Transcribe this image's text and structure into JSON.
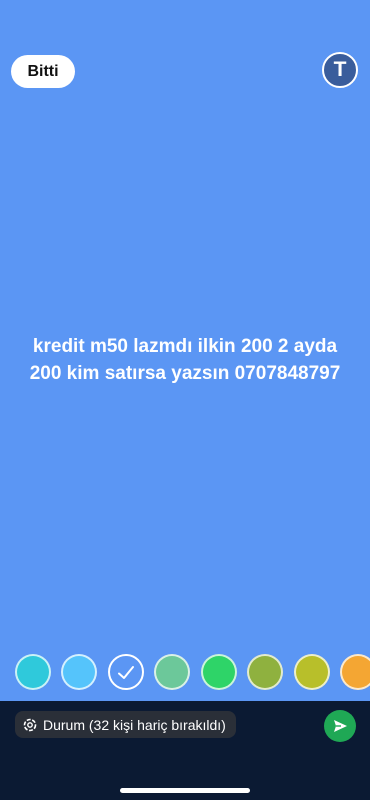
{
  "toolbar": {
    "done_label": "Bitti",
    "text_tool_label": "T"
  },
  "story": {
    "text": "kredit m50 lazmdı ilkin 200 2 ayda 200 kim satırsa yazsın 0707848797",
    "background_color": "#5b96f4"
  },
  "palette": {
    "colors": [
      "#2fc9db",
      "#55c4fb",
      "#5b96f4",
      "#6cc89a",
      "#2ed468",
      "#8fb13f",
      "#b8bf2a",
      "#f4a633"
    ],
    "selected_index": 2
  },
  "bottom": {
    "status_label": "Durum (32 kişi hariç bırakıldı)",
    "send_color": "#1fa855"
  }
}
